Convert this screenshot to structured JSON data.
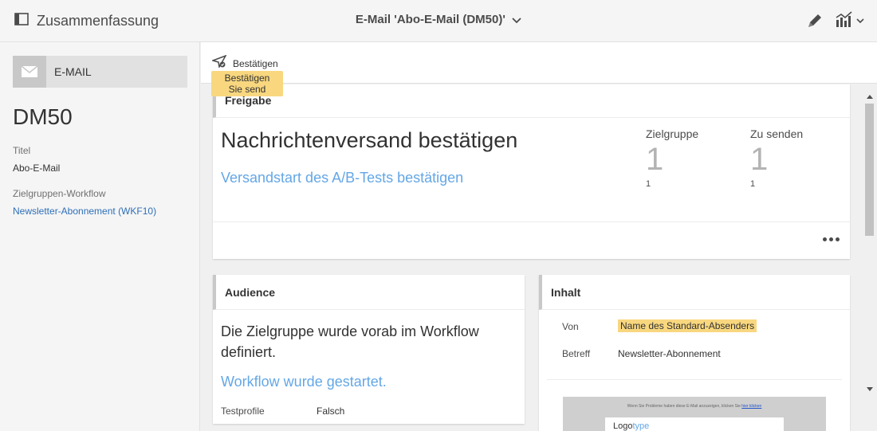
{
  "topbar": {
    "summary_label": "Zusammenfassung",
    "title": "E-Mail 'Abo-E-Mail (DM50)'"
  },
  "left": {
    "badge_label": "E-MAIL",
    "id": "DM50",
    "title_label": "Titel",
    "title_value": "Abo-E-Mail",
    "workflow_label": "Zielgruppen-Workflow",
    "workflow_value": "Newsletter-Abonnement (WKF10)"
  },
  "actionbar": {
    "confirm_label": "Bestätigen",
    "tooltip_line1": "Bestätigen",
    "tooltip_line2": "Sie send"
  },
  "freigabe": {
    "header": "Freigabe",
    "headline": "Nachrichtenversand bestätigen",
    "link": "Versandstart des A/B-Tests bestätigen",
    "stats": [
      {
        "label": "Zielgruppe",
        "value": "1",
        "sub": "1"
      },
      {
        "label": "Zu senden",
        "value": "1",
        "sub": "1"
      }
    ]
  },
  "audience": {
    "header": "Audience",
    "description": "Die Zielgruppe wurde vorab im Workflow definiert.",
    "link": "Workflow wurde gestartet.",
    "test_label": "Testprofile",
    "test_value": "Falsch"
  },
  "inhalt": {
    "header": "Inhalt",
    "from_label": "Von",
    "from_value": "Name des Standard-Absenders",
    "subject_label": "Betreff",
    "subject_value": "Newsletter-Abonnement",
    "preview_text": "Wenn Sie Probleme haben diese E-Mail anzuzeigen, klicken Sie",
    "preview_link": "hier klicken",
    "logo_word1": "Logo",
    "logo_word2": "type"
  },
  "colors": {
    "link": "#64a7e6",
    "accent_link": "#2d6fb8",
    "highlight": "#f8d77f"
  }
}
